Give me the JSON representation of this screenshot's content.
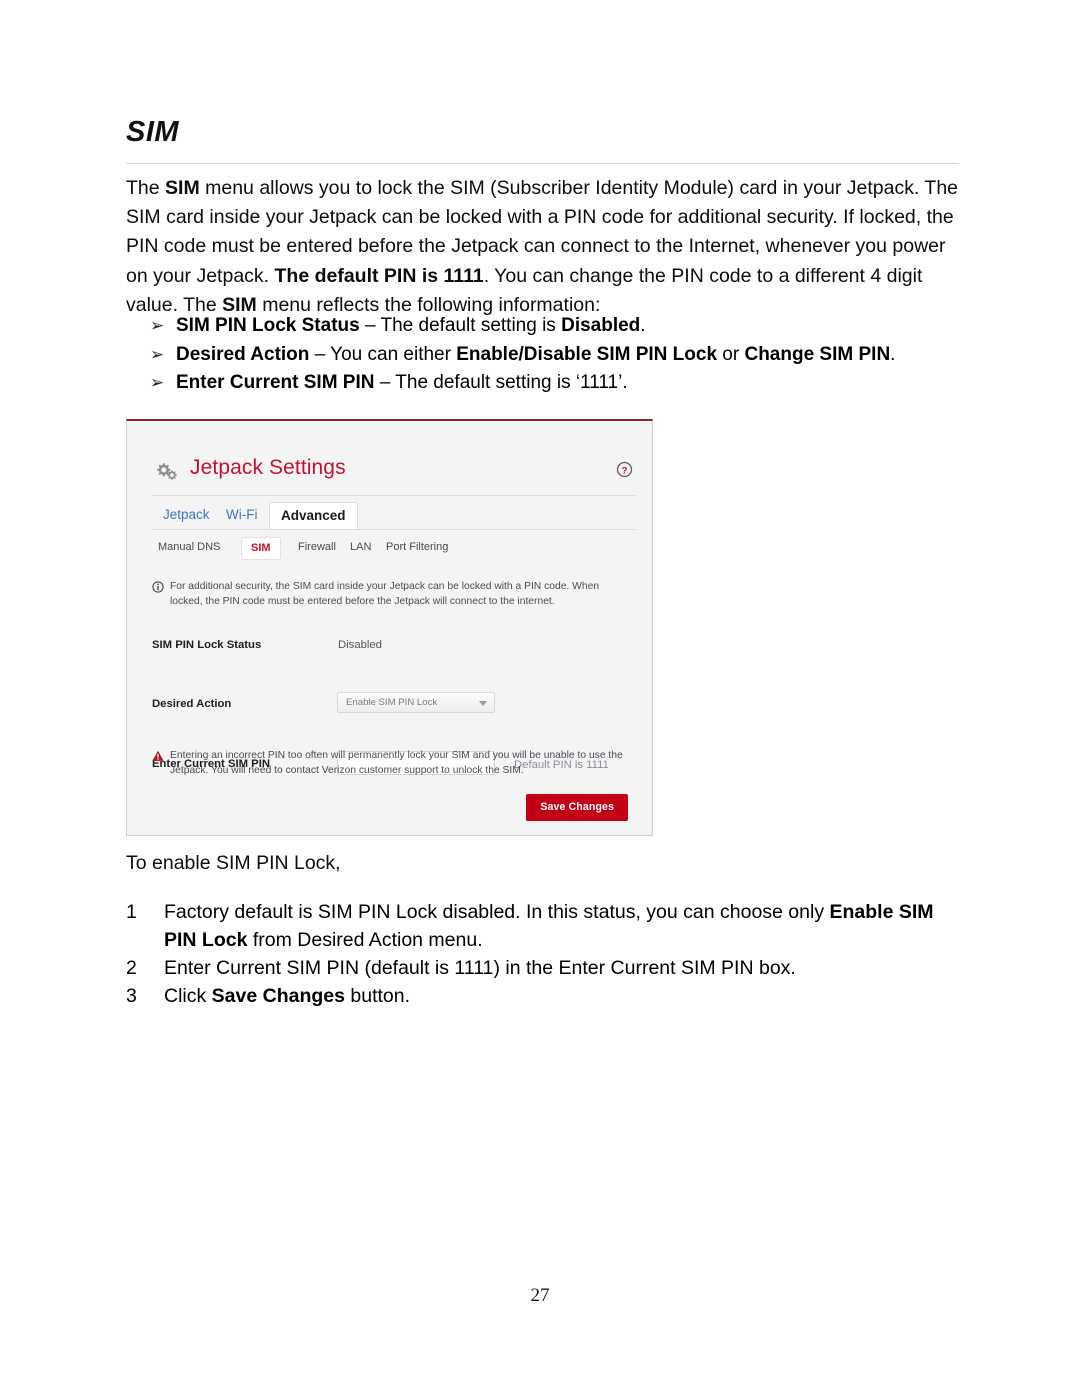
{
  "document": {
    "heading": "SIM",
    "intro_parts": [
      {
        "t": "The ",
        "b": false
      },
      {
        "t": "SIM",
        "b": true
      },
      {
        "t": " menu allows you to lock the SIM (Subscriber Identity Module) card in your Jetpack. The SIM card inside your Jetpack can be locked with a PIN code for additional security. If locked, the PIN code must be entered before the Jetpack can connect to the Internet, whenever you power on your Jetpack. ",
        "b": false
      },
      {
        "t": "The default PIN is 1111",
        "b": true
      },
      {
        "t": ". You can change the PIN code to a different 4 digit value. The ",
        "b": false
      },
      {
        "t": "SIM",
        "b": true
      },
      {
        "t": " menu reflects the following information:",
        "b": false
      }
    ],
    "bullet_marker": "➢",
    "bullets": [
      [
        {
          "t": "SIM PIN Lock Status",
          "b": true
        },
        {
          "t": " – The default setting is ",
          "b": false
        },
        {
          "t": "Disabled",
          "b": true
        },
        {
          "t": ".",
          "b": false
        }
      ],
      [
        {
          "t": "Desired Action",
          "b": true
        },
        {
          "t": " – You can either ",
          "b": false
        },
        {
          "t": "Enable/Disable SIM PIN Lock",
          "b": true
        },
        {
          "t": " or ",
          "b": false
        },
        {
          "t": "Change SIM PIN",
          "b": true
        },
        {
          "t": ".",
          "b": false
        }
      ],
      [
        {
          "t": "Enter Current SIM PIN",
          "b": true
        },
        {
          "t": " – The default setting is ‘1111’.",
          "b": false
        }
      ]
    ],
    "lead_in": "To enable SIM PIN Lock,",
    "steps": [
      {
        "num": "1",
        "parts": [
          {
            "t": "Factory default is SIM PIN Lock disabled. In this status, you can choose only ",
            "b": false
          },
          {
            "t": "Enable SIM PIN Lock",
            "b": true
          },
          {
            "t": " from Desired Action menu.",
            "b": false
          }
        ]
      },
      {
        "num": "2",
        "parts": [
          {
            "t": "Enter Current SIM PIN (default is 1111) in the Enter Current SIM PIN box.",
            "b": false
          }
        ]
      },
      {
        "num": "3",
        "parts": [
          {
            "t": "Click ",
            "b": false
          },
          {
            "t": "Save Changes",
            "b": true
          },
          {
            "t": " button.",
            "b": false
          }
        ]
      }
    ],
    "page_number": "27"
  },
  "screenshot": {
    "title": "Jetpack Settings",
    "icons": {
      "gear": "gear-icon",
      "help": "help-icon",
      "info": "info-icon",
      "warning": "warning-icon",
      "dropdown": "chevron-down-icon"
    },
    "tabs": [
      {
        "label": "Jetpack",
        "active": false
      },
      {
        "label": "Wi-Fi",
        "active": false
      },
      {
        "label": "Advanced",
        "active": true
      }
    ],
    "subtabs": [
      {
        "label": "Manual DNS",
        "active": false
      },
      {
        "label": "SIM",
        "active": true
      },
      {
        "label": "Firewall",
        "active": false
      },
      {
        "label": "LAN",
        "active": false
      },
      {
        "label": "Port Filtering",
        "active": false
      }
    ],
    "info_notice": "For additional security, the SIM card inside your Jetpack can be locked with a PIN code. When locked, the PIN code must be entered before the Jetpack will connect to the internet.",
    "warning_notice": "Entering an incorrect PIN too often will permanently lock your SIM and you will be unable to use the Jetpack. You will need to contact Verizon customer support to unlock the SIM.",
    "fields": {
      "status_label": "SIM PIN Lock Status",
      "status_value": "Disabled",
      "action_label": "Desired Action",
      "action_value": "Enable SIM PIN Lock",
      "pin_label": "Enter Current SIM PIN",
      "pin_value": "",
      "pin_hint": "Default PIN is 1111"
    },
    "save_button": "Save Changes",
    "colors": {
      "brand_red": "#c8102e",
      "button_red": "#c20016",
      "link_blue": "#3a78c3",
      "panel_bg": "#f4f4f4",
      "top_border": "#8d1f25"
    }
  }
}
